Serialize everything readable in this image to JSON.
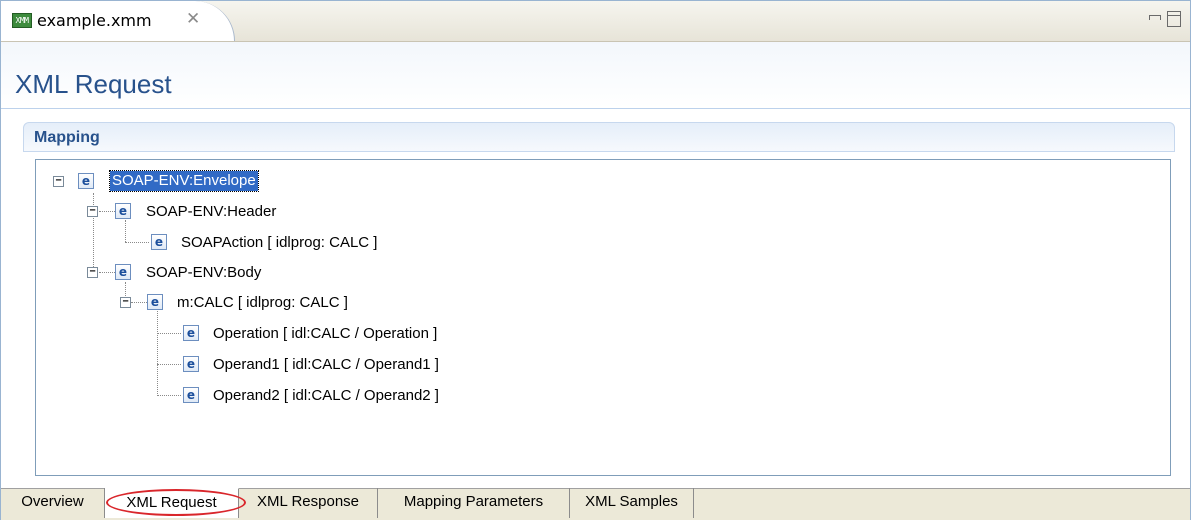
{
  "editor_tab": {
    "file_icon_text": "XMM",
    "file_name": "example.xmm",
    "close_symbol": "✕"
  },
  "form": {
    "title": "XML Request"
  },
  "section": {
    "title": "Mapping"
  },
  "tree": [
    {
      "label": "SOAP-ENV:Envelope",
      "icon": "e",
      "expander": "−",
      "selected": true
    },
    {
      "label": "SOAP-ENV:Header",
      "icon": "e",
      "expander": "−"
    },
    {
      "label": "SOAPAction  [ idlprog: CALC ]",
      "icon": "e"
    },
    {
      "label": "SOAP-ENV:Body",
      "icon": "e",
      "expander": "−"
    },
    {
      "label": "m:CALC  [ idlprog: CALC ]",
      "icon": "e",
      "expander": "−"
    },
    {
      "label": "Operation  [ idl:CALC / Operation ]",
      "icon": "e"
    },
    {
      "label": "Operand1  [ idl:CALC / Operand1 ]",
      "icon": "e"
    },
    {
      "label": "Operand2  [ idl:CALC / Operand2 ]",
      "icon": "e"
    }
  ],
  "page_tabs": [
    {
      "label": "Overview"
    },
    {
      "label": "XML Request",
      "active": true
    },
    {
      "label": "XML Response"
    },
    {
      "label": "Mapping Parameters"
    },
    {
      "label": "XML Samples"
    }
  ],
  "colors": {
    "title": "#28528c",
    "selection": "#316ac5",
    "highlight_circle": "#d9262b"
  },
  "icons": {
    "file": "xml-file-icon",
    "close": "close-icon",
    "minimize": "minimize-icon",
    "maximize": "maximize-icon",
    "element": "element-icon",
    "expander": "collapse-icon"
  }
}
